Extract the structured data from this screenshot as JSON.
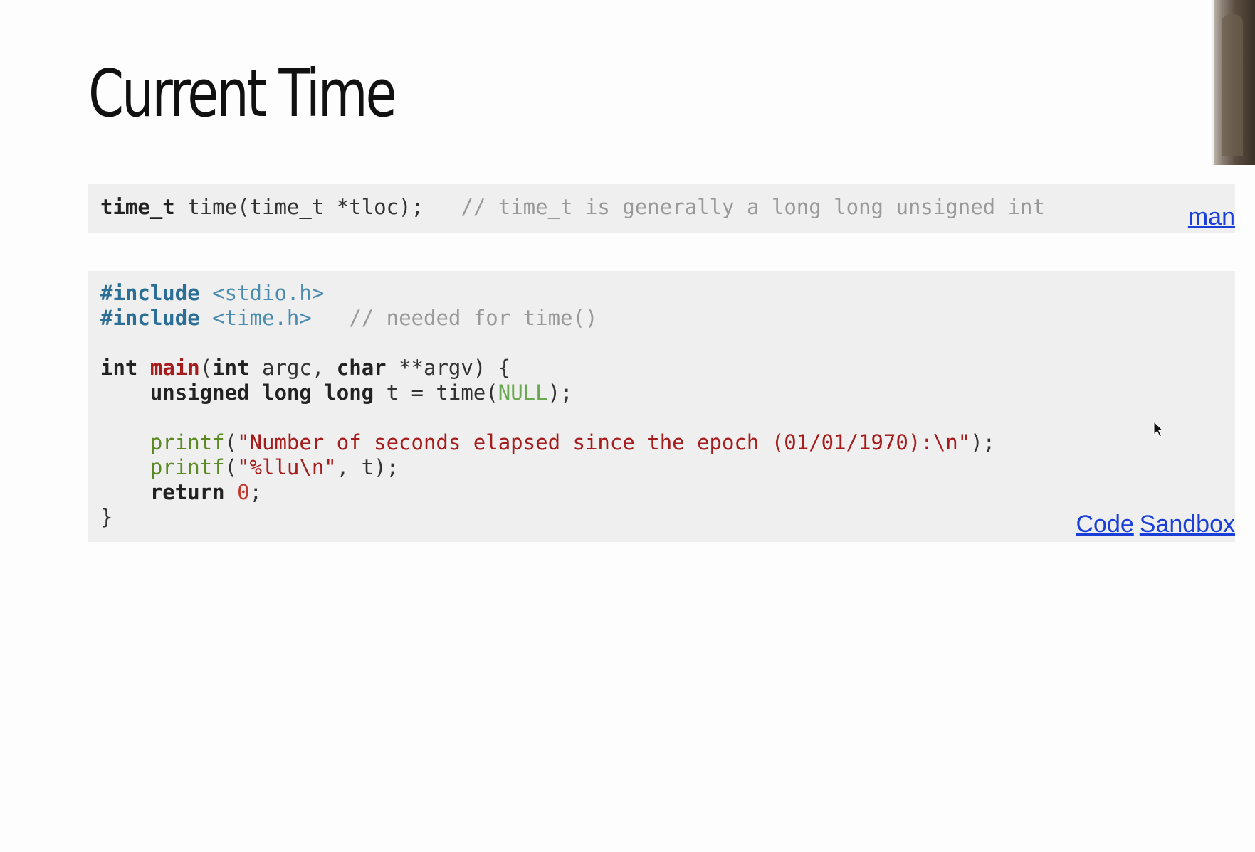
{
  "slide": {
    "title": "Current Time"
  },
  "signature": {
    "type": "time_t",
    "func": "time",
    "args": "(time_t *tloc);",
    "comment": "// time_t is generally a long long unsigned int",
    "link": "man"
  },
  "program": {
    "lines": {
      "inc1_kw": "#include",
      "inc1_hdr": "<stdio.h>",
      "inc2_kw": "#include",
      "inc2_hdr": "<time.h>",
      "inc2_cm": "// needed for time()",
      "main_int": "int",
      "main_name": "main",
      "main_rest1": "(",
      "main_int2": "int",
      "main_argc": " argc, ",
      "main_char": "char",
      "main_rest2": " **argv) {",
      "decl_kw": "unsigned long long",
      "decl_rest": " t = time(",
      "decl_null": "NULL",
      "decl_end": ");",
      "printf1_fn": "printf",
      "printf1_open": "(",
      "printf1_str": "\"Number of seconds elapsed since the epoch (01/01/1970):\\n\"",
      "printf1_end": ");",
      "printf2_fn": "printf",
      "printf2_open": "(",
      "printf2_str": "\"%llu\\n\"",
      "printf2_end": ", t);",
      "ret_kw": "return",
      "ret_num": "0",
      "ret_end": ";",
      "close": "}"
    },
    "links": [
      "Code",
      "Sandbox"
    ]
  },
  "colors": {
    "keyword": "#222222",
    "preprocessor": "#2b6e96",
    "string": "#a51c1c",
    "comment": "#999999",
    "link": "#1a3fd8",
    "code_background": "#efefef"
  },
  "icons": {
    "cursor": "mouse-pointer-icon"
  }
}
